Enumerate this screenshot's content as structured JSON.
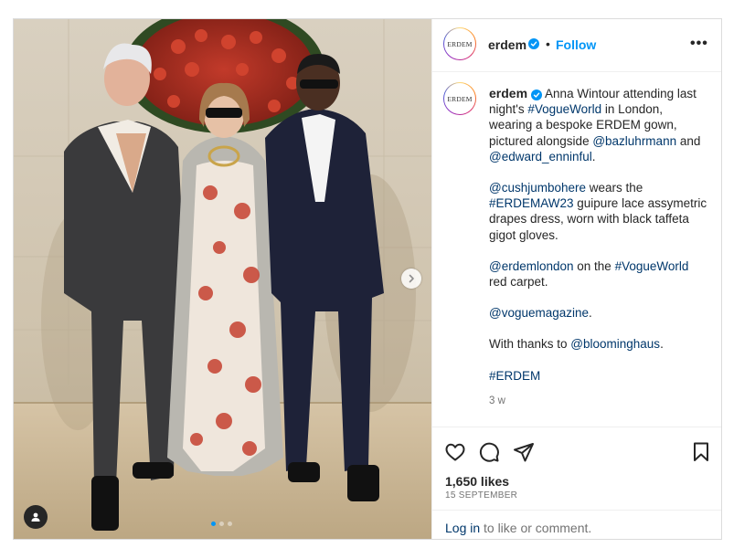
{
  "post": {
    "account": {
      "username": "erdem",
      "avatar_text": "ERDEM",
      "verified": true,
      "separator": "•",
      "follow_label": "Follow",
      "more_label": "•••"
    },
    "caption": {
      "username": "erdem",
      "paragraphs": [
        [
          {
            "text": "Anna Wintour attending last night's "
          },
          {
            "text": "#VogueWorld",
            "link": true
          },
          {
            "text": " in London, wearing a bespoke ERDEM gown, pictured alongside "
          },
          {
            "text": "@bazluhrmann",
            "link": true
          },
          {
            "text": " and "
          },
          {
            "text": "@edward_enninful",
            "link": true
          },
          {
            "text": "."
          }
        ],
        [
          {
            "text": "@cushjumbohere",
            "link": true
          },
          {
            "text": " wears the "
          },
          {
            "text": "#ERDEMAW23",
            "link": true
          },
          {
            "text": " guipure lace assymetric drapes dress, worn with black taffeta gigot gloves."
          }
        ],
        [
          {
            "text": "@erdemlondon",
            "link": true
          },
          {
            "text": " on the "
          },
          {
            "text": "#VogueWorld",
            "link": true
          },
          {
            "text": " red carpet."
          }
        ],
        [
          {
            "text": "@voguemagazine",
            "link": true
          },
          {
            "text": "."
          }
        ],
        [
          {
            "text": "With thanks to "
          },
          {
            "text": "@bloominghaus",
            "link": true
          },
          {
            "text": "."
          }
        ],
        [
          {
            "text": "#ERDEM",
            "link": true
          }
        ]
      ],
      "time_ago": "3 w"
    },
    "actions": {
      "like_icon": "heart-icon",
      "comment_icon": "comment-icon",
      "share_icon": "paper-plane-icon",
      "save_icon": "bookmark-icon"
    },
    "likes_text": "1,650 likes",
    "date_text": "15 SEPTEMBER",
    "login_prompt": {
      "link_text": "Log in",
      "rest_text": "to like or comment."
    },
    "media": {
      "carousel_index": 1,
      "carousel_count": 3,
      "next_icon": "chevron-right-icon",
      "tag_icon": "user-tag-icon"
    },
    "colors": {
      "brand_blue": "#0095f6",
      "link_navy": "#00376b",
      "text_primary": "#262626",
      "text_secondary": "#737373",
      "border": "#dbdbdb"
    }
  }
}
